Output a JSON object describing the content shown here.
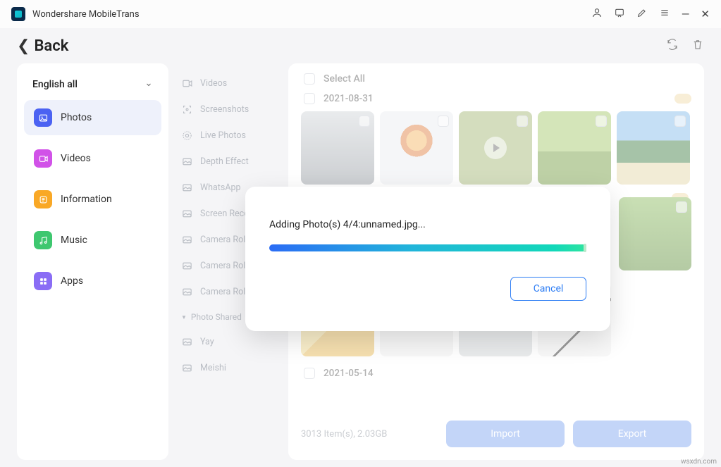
{
  "app": {
    "title": "Wondershare MobileTrans"
  },
  "back": {
    "label": "Back"
  },
  "sidebar": {
    "header": "English all",
    "items": [
      {
        "label": "Photos"
      },
      {
        "label": "Videos"
      },
      {
        "label": "Information"
      },
      {
        "label": "Music"
      },
      {
        "label": "Apps"
      }
    ]
  },
  "categories": {
    "items": [
      {
        "label": "Videos"
      },
      {
        "label": "Screenshots"
      },
      {
        "label": "Live Photos"
      },
      {
        "label": "Depth Effect"
      },
      {
        "label": "WhatsApp"
      },
      {
        "label": "Screen Recorder"
      },
      {
        "label": "Camera Roll"
      },
      {
        "label": "Camera Roll"
      },
      {
        "label": "Camera Roll"
      }
    ],
    "separator": "Photo Shared",
    "extra": [
      {
        "label": "Yay"
      },
      {
        "label": "Meishi"
      }
    ]
  },
  "content": {
    "select_all": "Select All",
    "dates": [
      "2021-08-31",
      "2021-05-14"
    ],
    "footer_info": "3013 Item(s), 2.03GB",
    "import": "Import",
    "export": "Export"
  },
  "modal": {
    "message": "Adding Photo(s) 4/4:unnamed.jpg...",
    "cancel": "Cancel"
  },
  "watermark": "wsxdn.com"
}
